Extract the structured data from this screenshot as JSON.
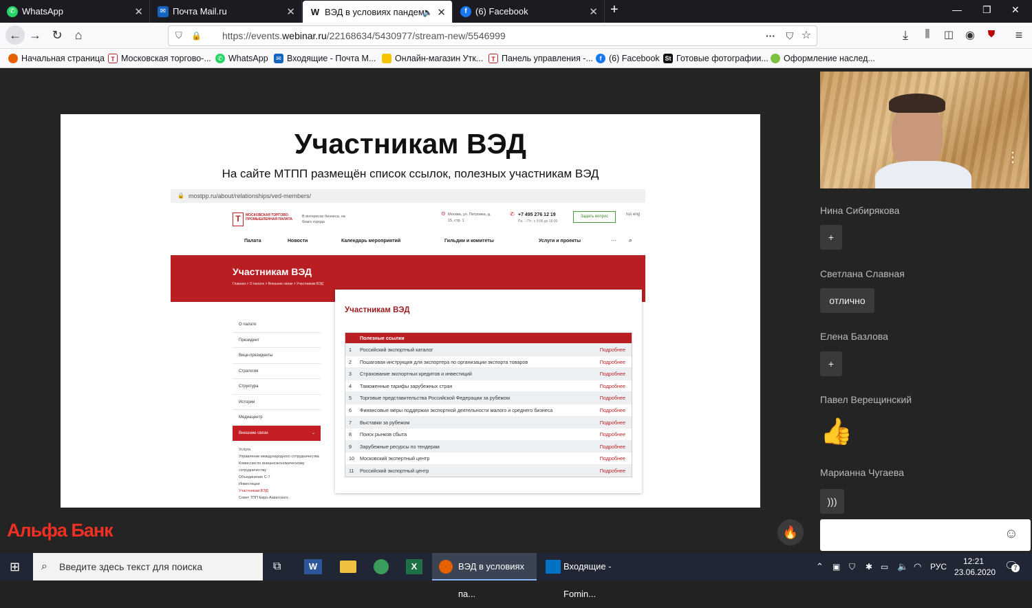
{
  "tabs": [
    {
      "label": "WhatsApp",
      "icon": "whatsapp-icon",
      "color": "#25d366"
    },
    {
      "label": "Почта Mail.ru",
      "icon": "mail-icon",
      "color": "#1565c0"
    },
    {
      "label": "ВЭД в условиях пандемии",
      "icon": "webinar-icon",
      "color": "#111111"
    },
    {
      "label": "(6) Facebook",
      "icon": "facebook-icon",
      "color": "#1877f2"
    }
  ],
  "url": {
    "prefix": "https://events.",
    "domain": "webinar.ru",
    "path": "/22168634/5430977/stream-new/5546999"
  },
  "bookmarks": [
    "Начальная страница",
    "Московская торгово-...",
    "WhatsApp",
    "Входящие - Почта М...",
    "Онлайн-магазин Утк...",
    "Панель управления -...",
    "(6) Facebook",
    "Готовые фотографии...",
    "Оформление наслед..."
  ],
  "slide": {
    "title": "Участникам ВЭД",
    "subtitle": "На сайте МТПП размещён список ссылок,  полезных участникам ВЭД",
    "site_url": "mostpp.ru/about/relationships/ved-members/",
    "logo_text": "МОСКОВСКАЯ ТОРГОВО-ПРОМЫШЛЕННАЯ ПАЛАТА",
    "tagline": "В интересах бизнеса, на благо города",
    "address": "Москва, ул. Петровка, д. 15, стр. 1",
    "phone": "+7 495 276 12 19",
    "hours": "Пн. – Пт.: с 9:00 до 18:00",
    "ask_button": "Задать вопрос",
    "lang": "rus eng",
    "menu": [
      "Палата",
      "Новости",
      "Календарь мероприятий",
      "Гильдии и комитеты",
      "Услуги и проекты",
      "···"
    ],
    "banner_title": "Участникам ВЭД",
    "breadcrumb": "Главная  >  О палате  >  Внешние связи  >  Участникам ВЭД",
    "sidebar": [
      "О палате",
      "Президент",
      "Вице-президенты",
      "Стратегия",
      "Структура",
      "История",
      "Медиацентр"
    ],
    "sidebar_active": "Внешние связи",
    "sidebar_sub": [
      "Услуги",
      "Управление международного сотрудничества",
      "Комиссии по внешнеэкономическому сотрудничеству",
      "Объединение С-7",
      "Инвестиции",
      "Участникам ВЭД",
      "Совет ТПП Евро-Азиатского"
    ],
    "card_title": "Участникам ВЭД",
    "table_header": "Полезные ссылки",
    "link_label": "Подробнее",
    "rows": [
      "Российский экспортный каталог",
      "Пошаговая инструкция для экспортера по организации экспорта товаров",
      "Страхование экспортных кредитов и инвестиций",
      "Таможенные тарифы зарубежных стран",
      "Торговые представительства Российской Федерации за рубежом",
      "Финансовые меры поддержки экспортной деятельности малого и среднего бизнеса",
      "Выставки за рубежом",
      "Поиск рынков сбыта",
      "Зарубежные ресурсы по тендерам",
      "Московский экспертный центр",
      "Российский экспортный центр"
    ]
  },
  "chat": [
    {
      "name": "Нина Сибирякова",
      "msg": "+"
    },
    {
      "name": "Светлана Славная",
      "msg": "отлично"
    },
    {
      "name": "Елена Базлова",
      "msg": "+"
    },
    {
      "name": "Павел Верещинский",
      "msg": "👍"
    },
    {
      "name": "Марианна Чугаева",
      "msg": ")))"
    }
  ],
  "brand": "Альфа Банк",
  "taskbar": {
    "search": "Введите здесь текст для поиска",
    "app1": "ВЭД в условиях па...",
    "app2": "Входящие - Fomin...",
    "lang": "РУС",
    "time": "12:21",
    "date": "23.06.2020",
    "notif": "7"
  }
}
